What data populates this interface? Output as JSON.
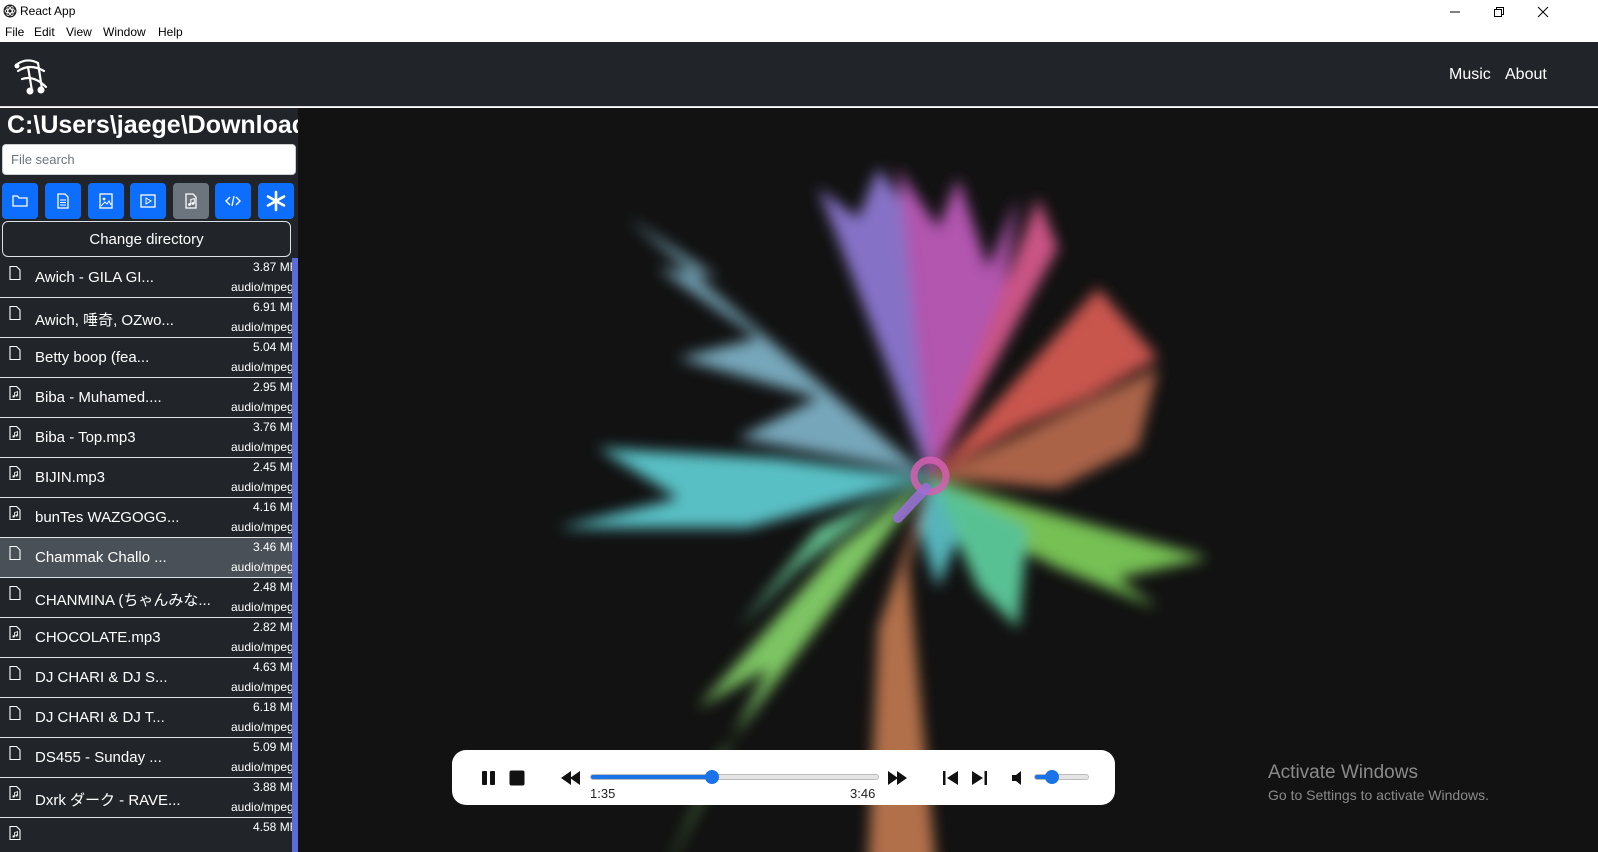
{
  "window": {
    "title": "React App"
  },
  "menu": [
    "File",
    "Edit",
    "View",
    "Window",
    "Help"
  ],
  "nav": {
    "links": [
      "Music",
      "About"
    ]
  },
  "sidebar": {
    "directory": "C:\\Users\\jaege\\Downloads",
    "search_placeholder": "File search",
    "filters": [
      {
        "icon": "folder-icon",
        "active": false
      },
      {
        "icon": "document-icon",
        "active": false
      },
      {
        "icon": "image-icon",
        "active": false
      },
      {
        "icon": "video-icon",
        "active": false
      },
      {
        "icon": "music-file-icon",
        "active": true
      },
      {
        "icon": "code-icon",
        "active": false
      },
      {
        "icon": "asterisk-icon",
        "active": false
      }
    ],
    "change_dir_label": "Change directory",
    "files": [
      {
        "name": "Awich - GILA GI...",
        "size": "3.87 MB",
        "type": "audio/mpeg",
        "icon": "file-icon",
        "selected": false
      },
      {
        "name": "Awich, 唾奇, OZwo...",
        "size": "6.91 MB",
        "type": "audio/mpeg",
        "icon": "file-icon",
        "selected": false
      },
      {
        "name": "Betty boop (fea...",
        "size": "5.04 MB",
        "type": "audio/mpeg",
        "icon": "file-icon",
        "selected": false
      },
      {
        "name": "Biba - Muhamed....",
        "size": "2.95 MB",
        "type": "audio/mpeg",
        "icon": "music-file-icon",
        "selected": false
      },
      {
        "name": "Biba - Top.mp3",
        "size": "3.76 MB",
        "type": "audio/mpeg",
        "icon": "music-file-icon",
        "selected": false
      },
      {
        "name": "BIJIN.mp3",
        "size": "2.45 MB",
        "type": "audio/mpeg",
        "icon": "music-file-icon",
        "selected": false
      },
      {
        "name": "bunTes WAZGOGG...",
        "size": "4.16 MB",
        "type": "audio/mpeg",
        "icon": "music-file-icon",
        "selected": false
      },
      {
        "name": "Chammak Challo ...",
        "size": "3.46 MB",
        "type": "audio/mpeg",
        "icon": "file-icon",
        "selected": true
      },
      {
        "name": "CHANMINA (ちゃんみな...",
        "size": "2.48 MB",
        "type": "audio/mpeg",
        "icon": "file-icon",
        "selected": false
      },
      {
        "name": "CHOCOLATE.mp3",
        "size": "2.82 MB",
        "type": "audio/mpeg",
        "icon": "music-file-icon",
        "selected": false
      },
      {
        "name": "DJ CHARI & DJ S...",
        "size": "4.63 MB",
        "type": "audio/mpeg",
        "icon": "file-icon",
        "selected": false
      },
      {
        "name": "DJ CHARI & DJ T...",
        "size": "6.18 MB",
        "type": "audio/mpeg",
        "icon": "file-icon",
        "selected": false
      },
      {
        "name": "DS455 - Sunday ...",
        "size": "5.09 MB",
        "type": "audio/mpeg",
        "icon": "file-icon",
        "selected": false
      },
      {
        "name": "Dxrk ダーク - RAVE...",
        "size": "3.88 MB",
        "type": "audio/mpeg",
        "icon": "music-file-icon",
        "selected": false
      },
      {
        "name": "",
        "size": "4.58 MB",
        "type": "",
        "icon": "music-file-icon",
        "selected": false
      }
    ]
  },
  "player": {
    "current_time": "1:35",
    "total_time": "3:46",
    "progress": 0.42,
    "volume": 0.3,
    "accent": "#1a73e8"
  },
  "watermark": {
    "title": "Activate Windows",
    "subtitle": "Go to Settings to activate Windows."
  }
}
